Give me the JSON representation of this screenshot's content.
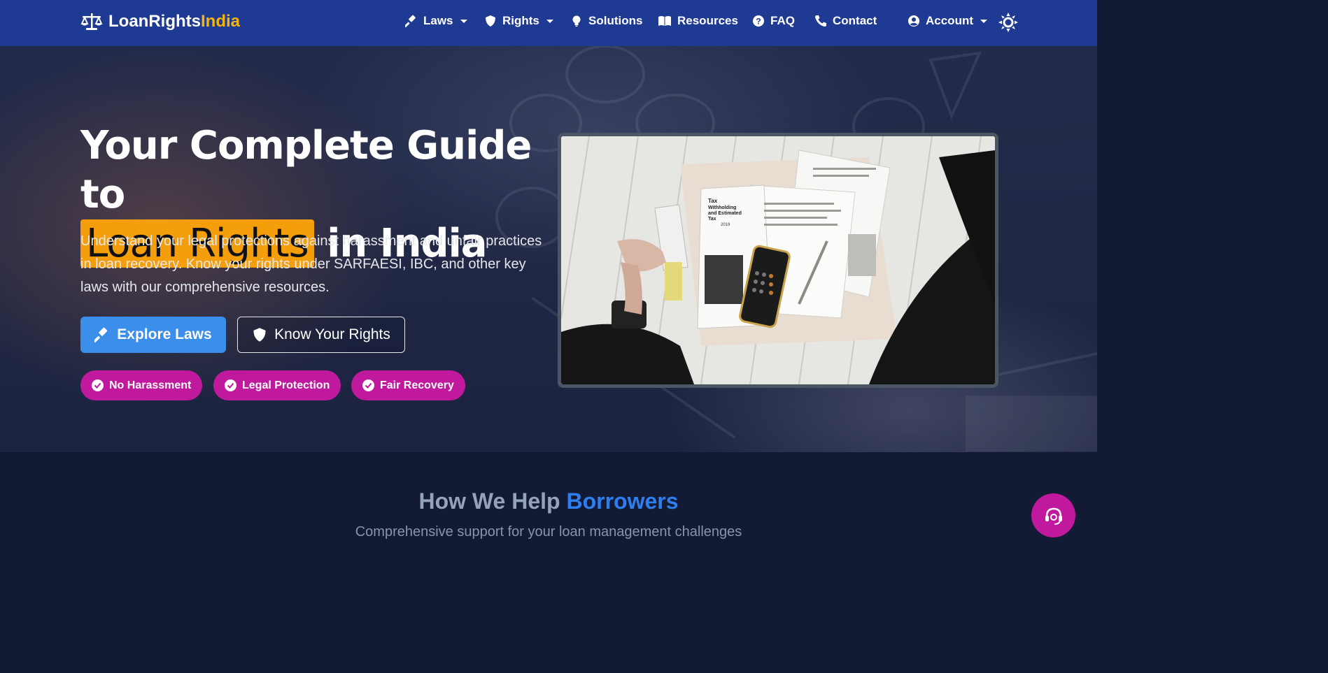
{
  "brand": {
    "name_part1": "LoanRights",
    "name_part2": "India",
    "accent_color": "#f5b50a",
    "icon": "scale-balance-icon"
  },
  "nav": {
    "items": [
      {
        "label": "Laws",
        "icon": "gavel-icon",
        "dropdown": true
      },
      {
        "label": "Rights",
        "icon": "shield-icon",
        "dropdown": true
      },
      {
        "label": "Solutions",
        "icon": "lightbulb-icon",
        "dropdown": false
      },
      {
        "label": "Resources",
        "icon": "book-icon",
        "dropdown": false
      },
      {
        "label": "FAQ",
        "icon": "question-circle-icon",
        "dropdown": false
      },
      {
        "label": "Contact",
        "icon": "phone-icon",
        "dropdown": false
      }
    ],
    "account": {
      "label": "Account",
      "icon": "user-circle-icon"
    },
    "theme_toggle_icon": "sun-icon",
    "bg_color": "#1f3a93"
  },
  "hero": {
    "title_line1": "Your Complete Guide to",
    "title_highlight": "Loan Rights",
    "title_rest": "in India",
    "highlight_color": "#f59e0b",
    "description": "Understand your legal protections against harassment and unfair practices in loan recovery. Know your rights under SARFAESI, IBC, and other key laws with our comprehensive resources.",
    "primary_button": {
      "label": "Explore Laws",
      "icon": "gavel-icon",
      "color": "#3b8eea"
    },
    "secondary_button": {
      "label": "Know Your Rights",
      "icon": "shield-icon"
    },
    "badges": [
      {
        "label": "No Harassment",
        "icon": "check-circle-icon"
      },
      {
        "label": "Legal Protection",
        "icon": "check-circle-icon"
      },
      {
        "label": "Fair Recovery",
        "icon": "check-circle-icon"
      }
    ],
    "badge_color": "#c0199e",
    "image_caption": {
      "heading": "Tax Withholding and Estimated Tax",
      "year": "2019"
    }
  },
  "help": {
    "title_part1": "How We Help",
    "title_accent": "Borrowers",
    "subtitle": "Comprehensive support for your loan management challenges",
    "accent_color": "#2f7ef0"
  },
  "chat_button_icon": "headset-icon"
}
